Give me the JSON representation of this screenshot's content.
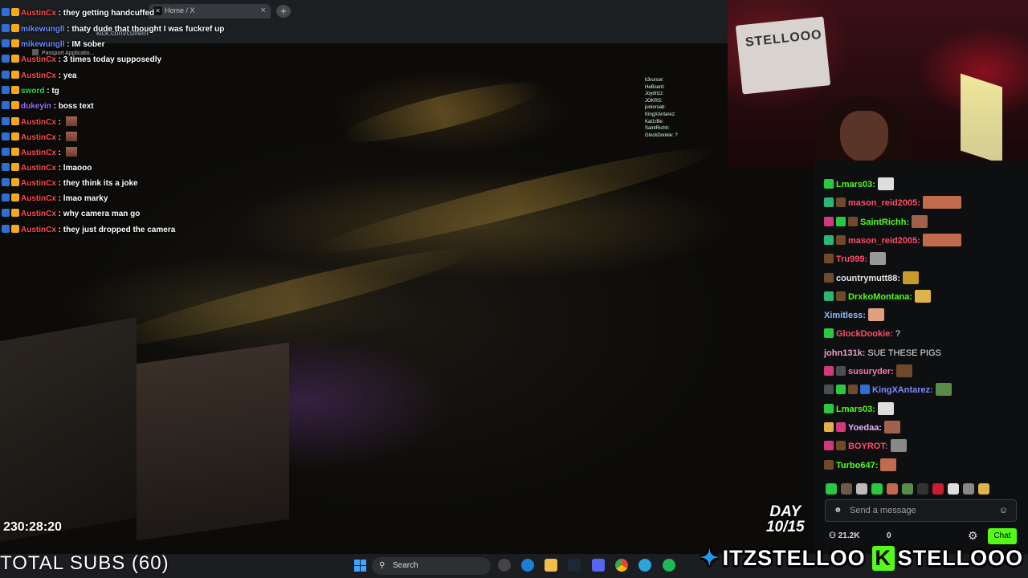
{
  "browser": {
    "tab_title": "Home / X",
    "tab_close": "×",
    "new_tab": "+",
    "url": "kick.com/cuffem",
    "bookmark": "Passport Applicatio..."
  },
  "chat_overlay": [
    {
      "user": "AustinCx",
      "text": "they getting handcuffed",
      "color": "#ff4d4d",
      "emote": false
    },
    {
      "user": "mikewungll",
      "text": "thaty dude that thought I was fuckref up",
      "color": "#6a8cff",
      "emote": false
    },
    {
      "user": "mikewungll",
      "text": "IM sober",
      "color": "#6a8cff",
      "emote": false
    },
    {
      "user": "AustinCx",
      "text": "3 times today supposedly",
      "color": "#ff4d4d",
      "emote": false
    },
    {
      "user": "AustinCx",
      "text": "yea",
      "color": "#ff4d4d",
      "emote": false
    },
    {
      "user": "sword",
      "text": "tg",
      "color": "#28d84a",
      "emote": false
    },
    {
      "user": "dukeyin",
      "text": "boss text",
      "color": "#9a6bff",
      "emote": false
    },
    {
      "user": "AustinCx",
      "text": "",
      "color": "#ff4d4d",
      "emote": true
    },
    {
      "user": "AustinCx",
      "text": "",
      "color": "#ff4d4d",
      "emote": true
    },
    {
      "user": "AustinCx",
      "text": "",
      "color": "#ff4d4d",
      "emote": true
    },
    {
      "user": "AustinCx",
      "text": "lmaooo",
      "color": "#ff4d4d",
      "emote": false
    },
    {
      "user": "AustinCx",
      "text": "they think its a joke",
      "color": "#ff4d4d",
      "emote": false
    },
    {
      "user": "AustinCx",
      "text": "lmao marky",
      "color": "#ff4d4d",
      "emote": false
    },
    {
      "user": "AustinCx",
      "text": "why camera man go",
      "color": "#ff4d4d",
      "emote": false
    },
    {
      "user": "AustinCx",
      "text": "they just dropped the camera",
      "color": "#ff4d4d",
      "emote": false
    }
  ],
  "mini_overlay": [
    "k3rursor:",
    "HeBsent:",
    "Joydrizz:",
    "JOKRS:",
    "juniorsab:",
    "KingXAntarez:",
    "Kat1rBe:",
    "SaintRichh:",
    "GlockDookie: ?"
  ],
  "stream": {
    "timer": "230:28:20",
    "day_label": "DAY",
    "day_value": "10/15"
  },
  "webcam": {
    "sign_text": "STELLOOO"
  },
  "right_chat": [
    {
      "user": "Lmars03:",
      "msg": "",
      "color": "#53fc18",
      "badges": [
        "#28c840"
      ],
      "emote": "#ddd"
    },
    {
      "user": "mason_reid2005:",
      "msg": "",
      "color": "#ff4d6a",
      "badges": [
        "#2bb673",
        "#6e4a2a"
      ],
      "emote": "#c26a4c"
    },
    {
      "user": "SaintRichh:",
      "msg": "",
      "color": "#53fc18",
      "badges": [
        "#d13a7a",
        "#28c840",
        "#6e4a2a"
      ],
      "emote": "#a0614a"
    },
    {
      "user": "mason_reid2005:",
      "msg": "",
      "color": "#ff4d6a",
      "badges": [
        "#2bb673",
        "#6e4a2a"
      ],
      "emote": "#c26a4c"
    },
    {
      "user": "Tru999:",
      "msg": "",
      "color": "#ff4d6a",
      "badges": [
        "#6e4a2a"
      ],
      "emote": "#999"
    },
    {
      "user": "countrymutt88:",
      "msg": "",
      "color": "#e8e8e8",
      "badges": [
        "#6e4a2a"
      ],
      "emote": "#c89a2c"
    },
    {
      "user": "DrxkoMontana:",
      "msg": "",
      "color": "#53fc18",
      "badges": [
        "#2bb673",
        "#6e4a2a"
      ],
      "emote": "#e0b24a"
    },
    {
      "user": "Ximitless:",
      "msg": "",
      "color": "#8fb8ff",
      "badges": [],
      "emote": "#e0a080"
    },
    {
      "user": "GlockDookie:",
      "msg": "?",
      "color": "#ff4d6a",
      "badges": [
        "#28c840"
      ],
      "emote": ""
    },
    {
      "user": "john131k:",
      "msg": "SUE THESE PIGS",
      "color": "#e8a0c8",
      "badges": [],
      "emote": ""
    },
    {
      "user": "susuryder:",
      "msg": "",
      "color": "#ff77aa",
      "badges": [
        "#d13a7a",
        "#4a4d52"
      ],
      "emote": "#6e4a2a"
    },
    {
      "user": "KingXAntarez:",
      "msg": "",
      "color": "#7a8cff",
      "badges": [
        "#4a4d52",
        "#28c840",
        "#6e4a2a",
        "#2d6fd6"
      ],
      "emote": "#5a8a4a"
    },
    {
      "user": "Lmars03:",
      "msg": "",
      "color": "#53fc18",
      "badges": [
        "#28c840"
      ],
      "emote": "#ddd"
    },
    {
      "user": "Yoedaa:",
      "msg": "",
      "color": "#e8b0ff",
      "badges": [
        "#e0b24a",
        "#d13a7a"
      ],
      "emote": "#a0614a"
    },
    {
      "user": "BOYROT:",
      "msg": "",
      "color": "#ff4d6a",
      "badges": [
        "#d13a7a",
        "#6e4a2a"
      ],
      "emote": "#888"
    },
    {
      "user": "Turbo647:",
      "msg": "",
      "color": "#53fc18",
      "badges": [
        "#6e4a2a"
      ],
      "emote": "#c26a4c"
    }
  ],
  "chat_input": {
    "placeholder": "Send a message",
    "viewers": "21.2K",
    "count": "0",
    "chat_button": "Chat"
  },
  "taskbar": {
    "subs": "TOTAL SUBS (60)",
    "search": "Search"
  },
  "socials": {
    "twitter": "ITZSTELLOO",
    "kick": "STELLOOO",
    "kick_logo": "K"
  },
  "colors": {
    "kick_green": "#53fc18",
    "twitter_blue": "#1d9bf0"
  }
}
